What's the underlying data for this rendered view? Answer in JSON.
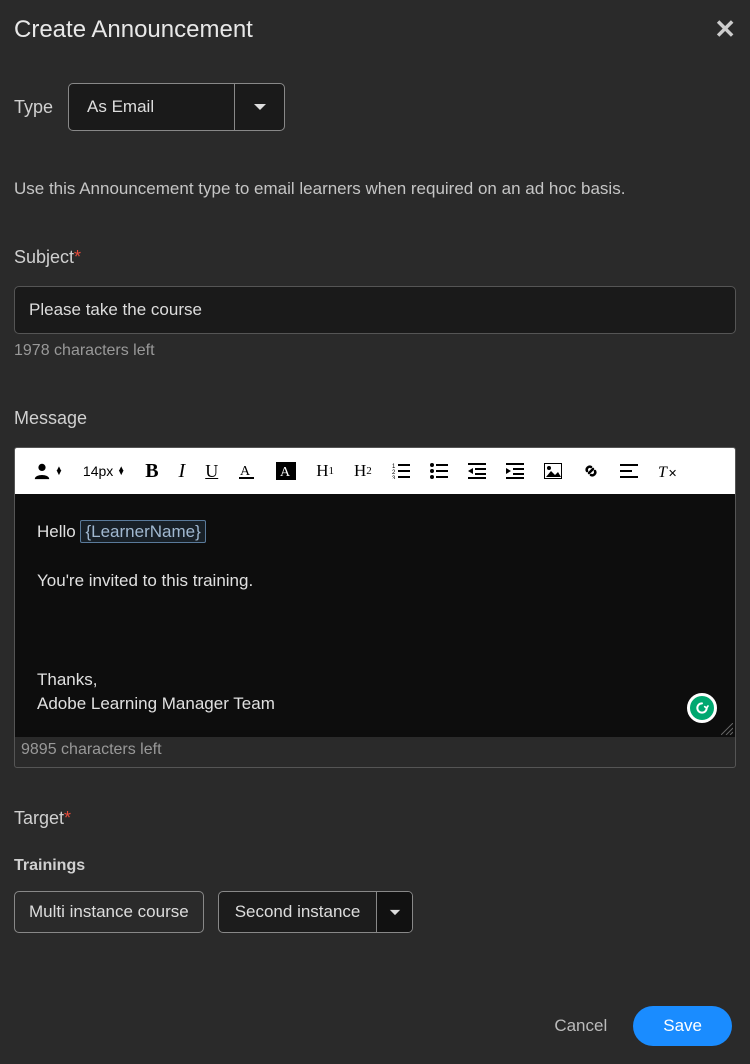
{
  "header": {
    "title": "Create Announcement"
  },
  "type": {
    "label": "Type",
    "value": "As Email"
  },
  "help": "Use this Announcement type to email learners when required on an ad hoc basis.",
  "subject": {
    "label": "Subject",
    "value": "Please take the course",
    "counter": "1978 characters left"
  },
  "message": {
    "label": "Message",
    "fontsize": "14px",
    "body": {
      "greeting": "Hello ",
      "token": "{LearnerName}",
      "line2": "You're invited to this training.",
      "sign1": "Thanks,",
      "sign2": "Adobe Learning Manager Team"
    },
    "counter": "9895 characters left"
  },
  "target": {
    "label": "Target",
    "trainings_label": "Trainings",
    "chip": "Multi instance course",
    "instance": "Second instance"
  },
  "footer": {
    "cancel": "Cancel",
    "save": "Save"
  }
}
